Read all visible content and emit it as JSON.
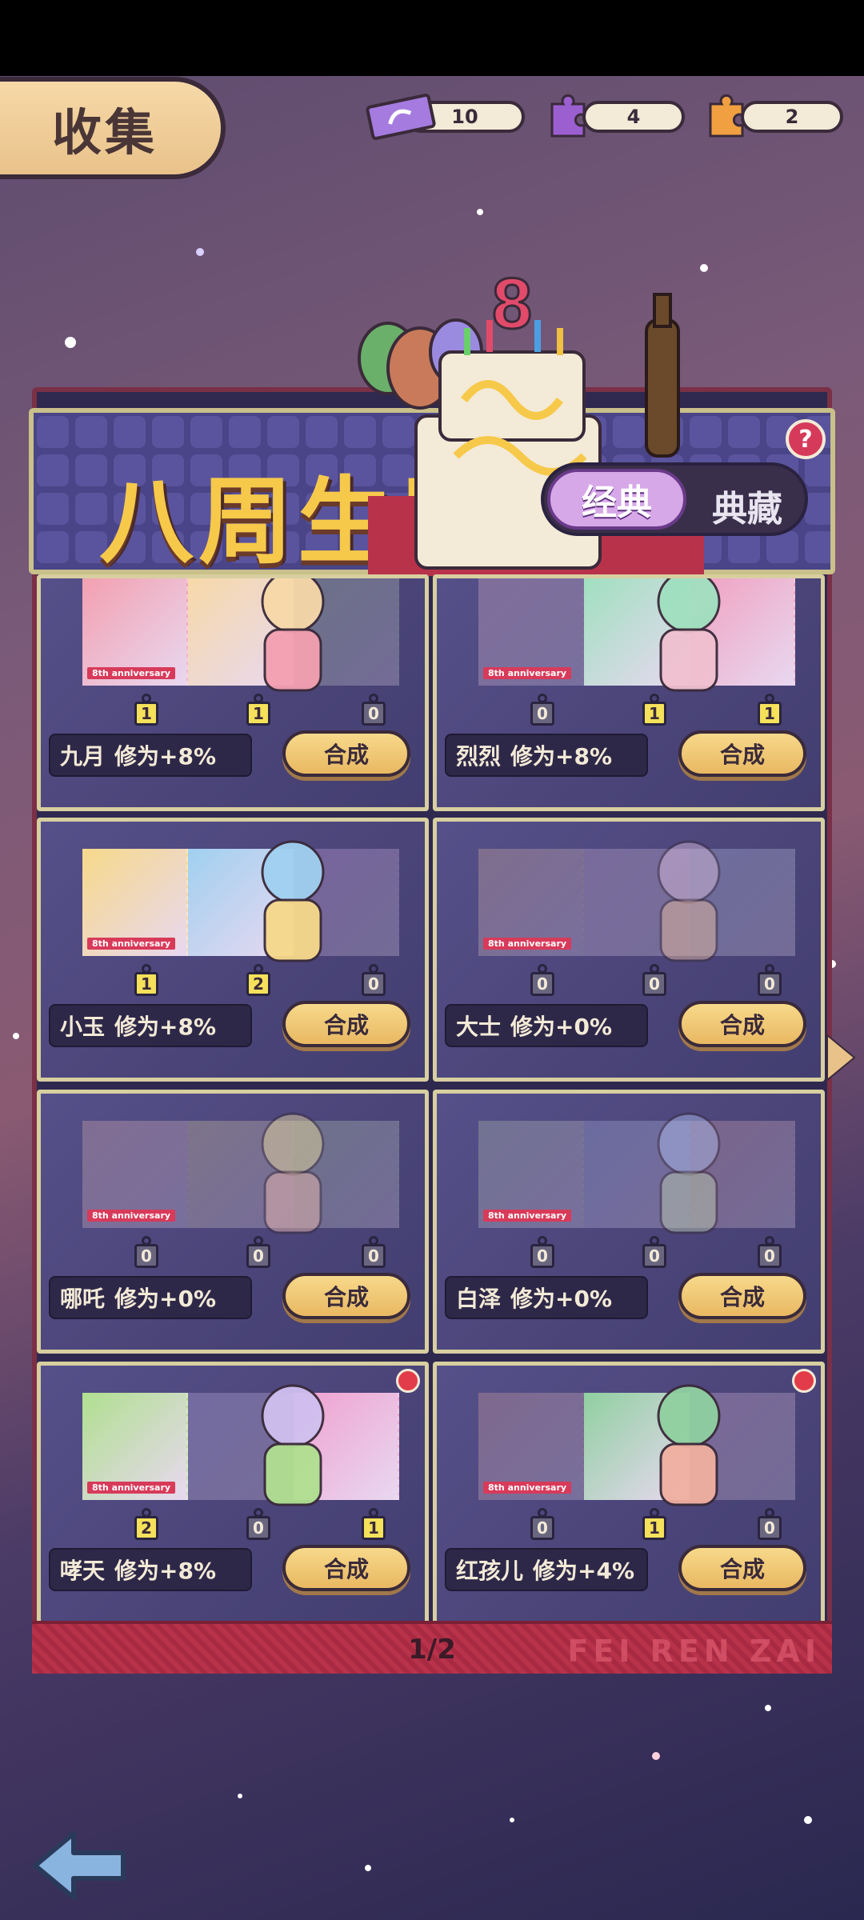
{
  "header": {
    "title": "收集",
    "currencies": [
      {
        "icon": "ticket-icon",
        "value": "10",
        "color": "#a67be0"
      },
      {
        "icon": "purple-puzzle-icon",
        "value": "4",
        "color": "#9b5fd0"
      },
      {
        "icon": "orange-puzzle-icon",
        "value": "2",
        "color": "#f0a040"
      }
    ]
  },
  "banner": {
    "title": "八周生辰",
    "tab_active": "经典",
    "tab_inactive": "典藏",
    "help": "?"
  },
  "cards": [
    {
      "name": "九月",
      "bonus": "修为+8%",
      "pieces": [
        "1",
        "1",
        "0"
      ],
      "button": "合成",
      "dot": false
    },
    {
      "name": "烈烈",
      "bonus": "修为+8%",
      "pieces": [
        "0",
        "1",
        "1"
      ],
      "button": "合成",
      "dot": false
    },
    {
      "name": "小玉",
      "bonus": "修为+8%",
      "pieces": [
        "1",
        "2",
        "0"
      ],
      "button": "合成",
      "dot": false
    },
    {
      "name": "大士",
      "bonus": "修为+0%",
      "pieces": [
        "0",
        "0",
        "0"
      ],
      "button": "合成",
      "dot": false
    },
    {
      "name": "哪吒",
      "bonus": "修为+0%",
      "pieces": [
        "0",
        "0",
        "0"
      ],
      "button": "合成",
      "dot": false
    },
    {
      "name": "白泽",
      "bonus": "修为+0%",
      "pieces": [
        "0",
        "0",
        "0"
      ],
      "button": "合成",
      "dot": false
    },
    {
      "name": "哮天",
      "bonus": "修为+8%",
      "pieces": [
        "2",
        "0",
        "1"
      ],
      "button": "合成",
      "dot": true
    },
    {
      "name": "红孩儿",
      "bonus": "修为+4%",
      "pieces": [
        "0",
        "1",
        "0"
      ],
      "button": "合成",
      "dot": true
    }
  ],
  "ticket_label": "8th anniversary",
  "pager": {
    "page": "1/2",
    "brand": "FEI REN ZAI"
  }
}
